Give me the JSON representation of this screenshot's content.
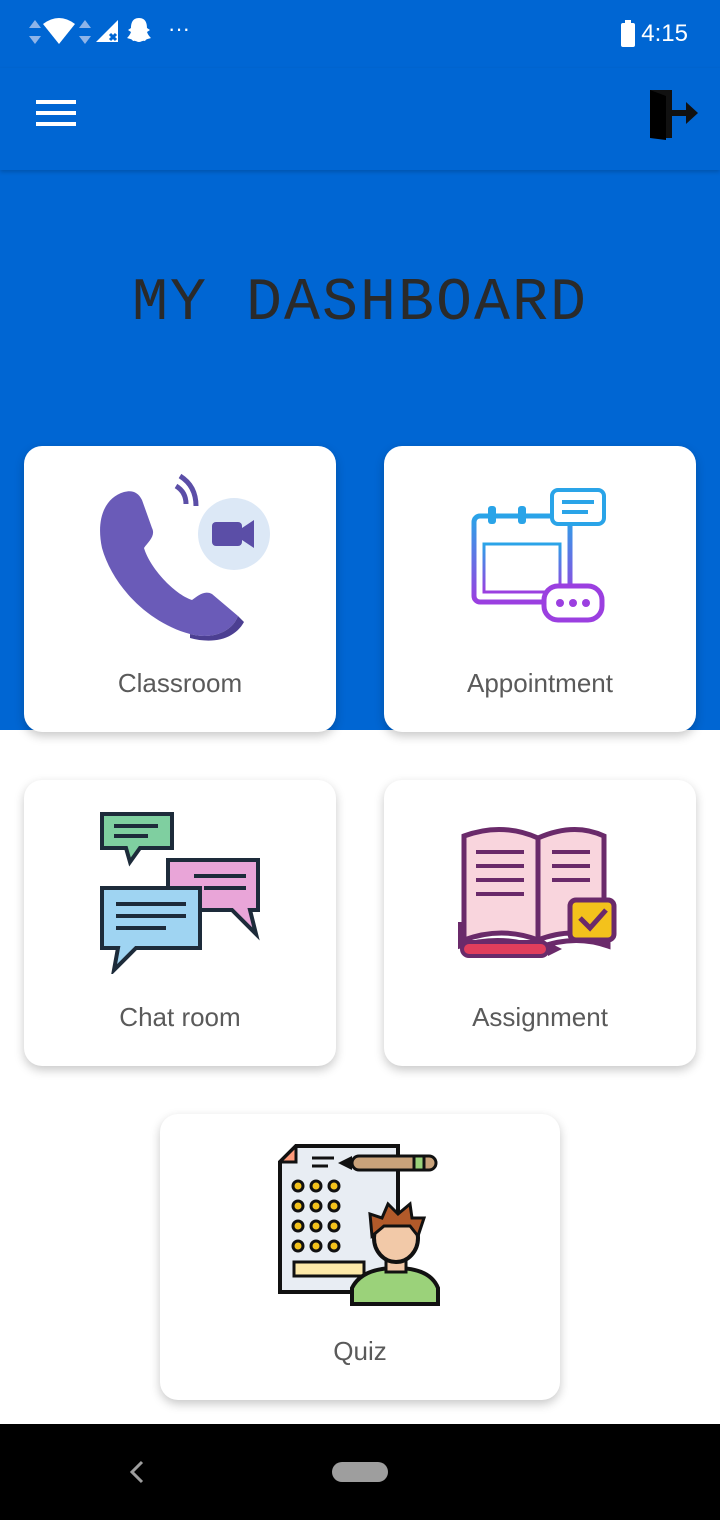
{
  "status_bar": {
    "time": "4:15",
    "more": "···"
  },
  "header": {
    "title": "MY DASHBOARD"
  },
  "tiles": [
    {
      "label": "Classroom",
      "icon": "video-call-icon"
    },
    {
      "label": "Appointment",
      "icon": "calendar-chat-icon"
    },
    {
      "label": "Chat room",
      "icon": "chat-bubbles-icon"
    },
    {
      "label": "Assignment",
      "icon": "open-book-check-icon"
    },
    {
      "label": "Quiz",
      "icon": "quiz-sheet-icon"
    }
  ],
  "colors": {
    "primary": "#0066d3",
    "card": "#ffffff",
    "label": "#5a5a5a"
  }
}
